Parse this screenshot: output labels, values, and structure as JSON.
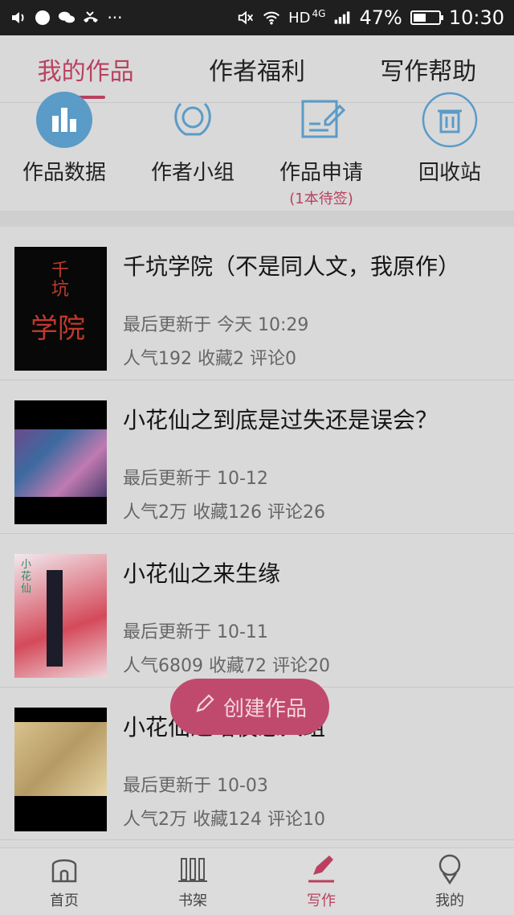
{
  "status_bar": {
    "hd_label": "HD",
    "network": "4G",
    "battery_percent": "47%",
    "time": "10:30",
    "battery_level": 0.47
  },
  "tabs": [
    {
      "label": "我的作品",
      "active": true
    },
    {
      "label": "作者福利",
      "active": false
    },
    {
      "label": "写作帮助",
      "active": false
    }
  ],
  "actions": [
    {
      "label": "作品数据",
      "icon": "chart-icon"
    },
    {
      "label": "作者小组",
      "icon": "group-icon"
    },
    {
      "label": "作品申请",
      "icon": "edit-doc-icon",
      "sub": "(1本待签)"
    },
    {
      "label": "回收站",
      "icon": "trash-icon"
    }
  ],
  "works": [
    {
      "title": "千坑学院（不是同人文，我原作）",
      "updated": "最后更新于 今天 10:29",
      "stats": "人气192 收藏2 评论0",
      "cover_text_1": "千",
      "cover_text_2": "坑",
      "cover_text_3": "学院"
    },
    {
      "title": "小花仙之到底是过失还是误会？",
      "updated": "最后更新于 10-12",
      "stats": "人气2万 收藏126 评论26"
    },
    {
      "title": "小花仙之来生缘",
      "updated": "最后更新于 10-11",
      "stats": "人气6809 收藏72 评论20",
      "cover_text_1": "小",
      "cover_text_2": "花",
      "cover_text_3": "仙"
    },
    {
      "title": "小花仙之暗夜恋人组",
      "updated": "最后更新于 10-03",
      "stats": "人气2万 收藏124 评论10"
    }
  ],
  "fab": {
    "label": "创建作品"
  },
  "bottom_nav": [
    {
      "label": "首页"
    },
    {
      "label": "书架"
    },
    {
      "label": "写作"
    },
    {
      "label": "我的"
    }
  ],
  "colors": {
    "accent": "#b94160",
    "icon_blue": "#5b9bc7",
    "fab": "#c04a6e"
  }
}
